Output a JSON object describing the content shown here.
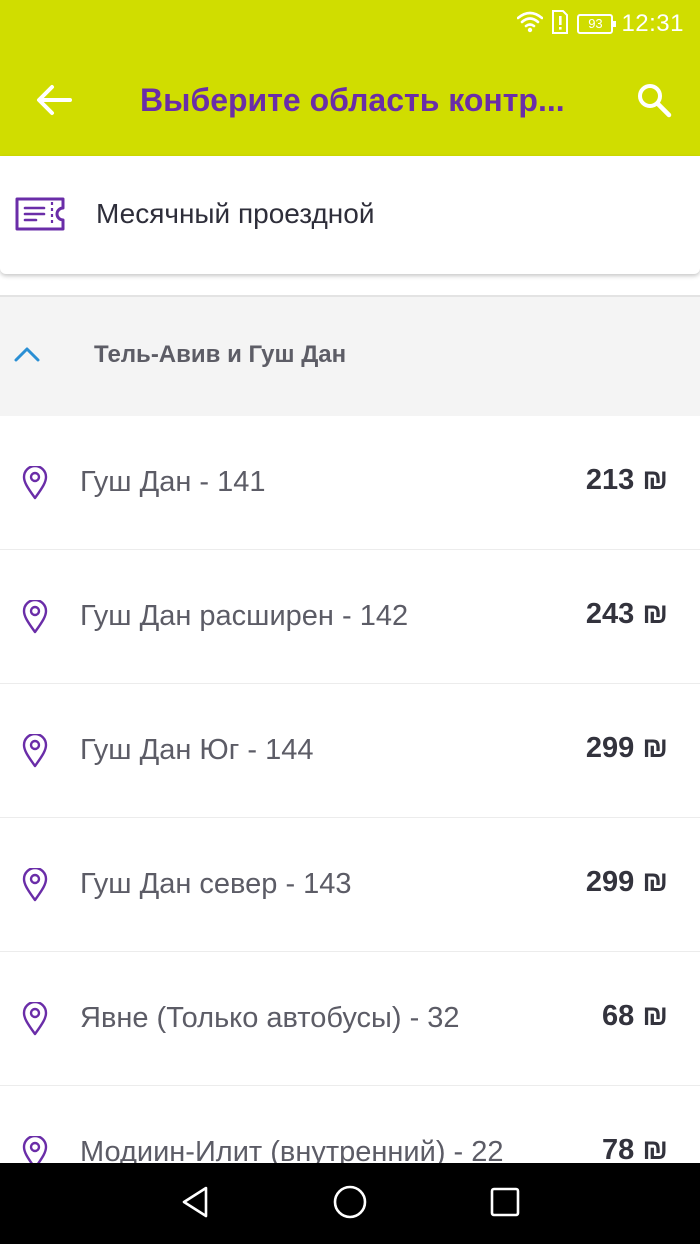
{
  "status_bar": {
    "battery": "93",
    "time": "12:31"
  },
  "app_bar": {
    "title": "Выберите область контр...",
    "back_icon": "arrow-left-icon",
    "search_icon": "search-icon"
  },
  "ticket": {
    "icon": "ticket-icon",
    "label": "Месячный проездной"
  },
  "section": {
    "title": "Тель-Авив и Гуш Дан",
    "expanded": true
  },
  "areas": [
    {
      "name": "Гуш Дан - 141",
      "price": "213 ₪"
    },
    {
      "name": "Гуш Дан расширен - 142",
      "price": "243 ₪"
    },
    {
      "name": "Гуш Дан Юг - 144",
      "price": "299 ₪"
    },
    {
      "name": "Гуш Дан север - 143",
      "price": "299 ₪"
    },
    {
      "name": "Явне (Только автобусы) - 32",
      "price": "68 ₪"
    },
    {
      "name": "Модиин-Илит (внутренний) - 22",
      "price": "78 ₪"
    }
  ],
  "colors": {
    "app_bar": "#d0dd00",
    "accent": "#6a2da8",
    "chevron": "#2a8fd4"
  }
}
